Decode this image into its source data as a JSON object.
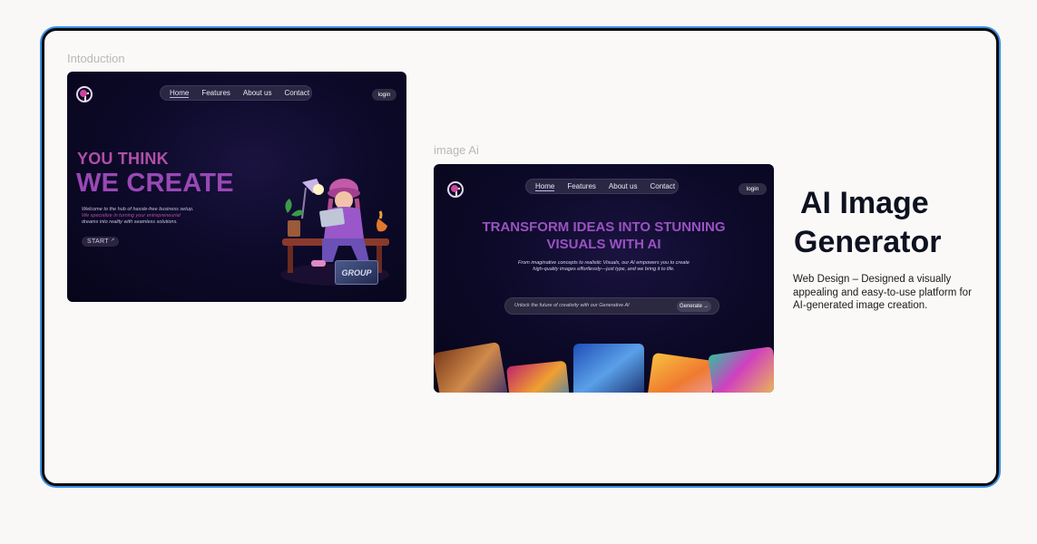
{
  "captions": {
    "intro": "Intoduction",
    "image_ai": "image Ai"
  },
  "nav_items": [
    "Home",
    "Features",
    "About us",
    "Contact"
  ],
  "login_label": "login",
  "intro_shot": {
    "headline_line1": "YOU THINK",
    "headline_line2": "WE CREATE",
    "tagline_1": "Welcome to the hub of hassle-free business setup.",
    "tagline_2": "We specialize in turning your entrepreneurial",
    "tagline_3": "dreams into reality with seamless solutions.",
    "start_label": "START",
    "start_arrow": "↗",
    "cube_text": "GROUP"
  },
  "ai_shot": {
    "headline_line1": "TRANSFORM IDEAS INTO STUNNING",
    "headline_line2": "VISUALS WITH AI",
    "sub_line1": "From imaginative concepts to realistic Visuals, our AI empowers you to create",
    "sub_line2": "high-quality images effortlessly—just type, and we bring it to life.",
    "search_placeholder": "Unlock the future of creativity with our Generative AI",
    "generate_label": "Generate",
    "generate_arrow": "→"
  },
  "project": {
    "title_line1": "AI Image",
    "title_line2": "Generator",
    "desc_line1": "Web Design – Designed a visually",
    "desc_line2": "appealing and easy-to-use platform for",
    "desc_line3": "AI-generated image creation."
  },
  "colors": {
    "accent_purple": "#8b3fb0",
    "frame_border": "#0b0b0b",
    "frame_glow": "#3a8ee6",
    "dark_bg": "#0d0a2a"
  }
}
